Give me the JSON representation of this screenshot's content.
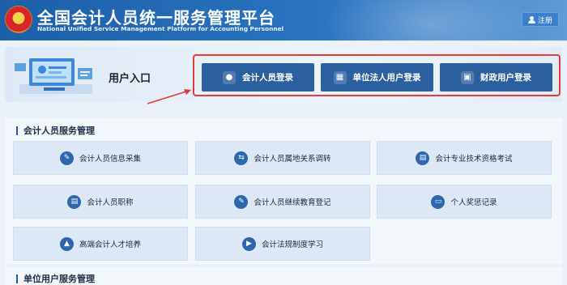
{
  "header": {
    "title_cn": "全国会计人员统一服务管理平台",
    "title_en": "National Unified Service Management Platform for Accounting Personnel",
    "register_label": "注册"
  },
  "login": {
    "entry_label": "用户入口",
    "buttons": [
      {
        "label": "会计人员登录",
        "icon": "user-icon"
      },
      {
        "label": "单位法人用户登录",
        "icon": "building-chart-icon"
      },
      {
        "label": "财政用户登录",
        "icon": "id-card-icon"
      }
    ]
  },
  "sections": [
    {
      "title": "会计人员服务管理",
      "items": [
        {
          "label": "会计人员信息采集",
          "icon": "form-edit-icon"
        },
        {
          "label": "会计人员属地关系调转",
          "icon": "transfer-icon"
        },
        {
          "label": "会计专业技术资格考试",
          "icon": "exam-paper-icon"
        },
        {
          "label": "会计人员职称",
          "icon": "certificate-icon"
        },
        {
          "label": "会计人员继续教育登记",
          "icon": "education-register-icon"
        },
        {
          "label": "个人奖惩记录",
          "icon": "record-icon"
        },
        {
          "label": "高端会计人才培养",
          "icon": "graduation-cap-icon"
        },
        {
          "label": "会计法规制度学习",
          "icon": "video-play-icon"
        }
      ]
    },
    {
      "title": "单位用户服务管理",
      "items": []
    }
  ],
  "colors": {
    "header": "#2468b3",
    "login_button": "#2c5f9e",
    "highlight_border": "#e43b3b",
    "tile_bg": "#dce8f5",
    "icon_circle": "#2e67ad"
  }
}
